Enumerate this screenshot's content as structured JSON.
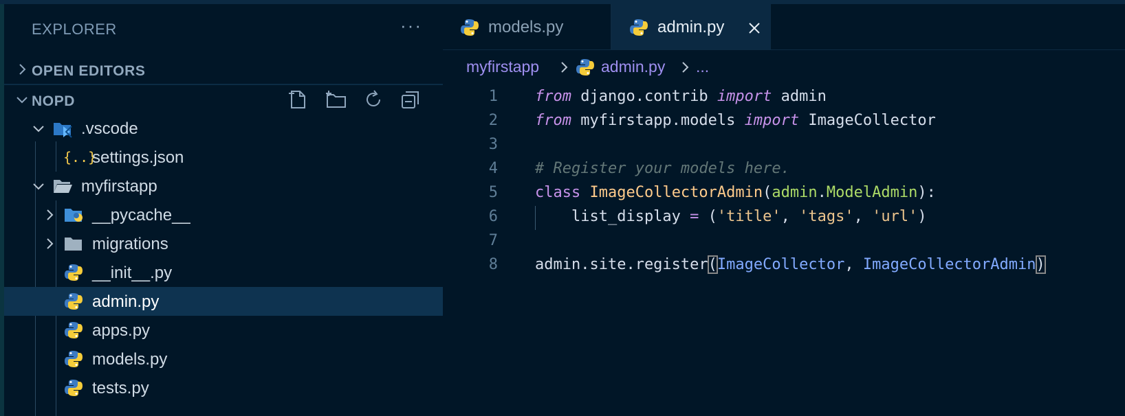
{
  "sidebar": {
    "title": "EXPLORER",
    "more_label": "···",
    "open_editors_label": "OPEN EDITORS",
    "project_label": "NOPD",
    "tree": [
      {
        "name": ".vscode",
        "kind": "folder-vscode",
        "expanded": true
      },
      {
        "name": "settings.json",
        "kind": "json"
      },
      {
        "name": "myfirstapp",
        "kind": "folder-open",
        "expanded": true
      },
      {
        "name": "__pycache__",
        "kind": "folder-python",
        "expanded": false
      },
      {
        "name": "migrations",
        "kind": "folder",
        "expanded": false
      },
      {
        "name": "__init__.py",
        "kind": "python"
      },
      {
        "name": "admin.py",
        "kind": "python",
        "selected": true
      },
      {
        "name": "apps.py",
        "kind": "python"
      },
      {
        "name": "models.py",
        "kind": "python"
      },
      {
        "name": "tests.py",
        "kind": "python"
      }
    ]
  },
  "tabs": [
    {
      "label": "models.py",
      "active": false
    },
    {
      "label": "admin.py",
      "active": true
    }
  ],
  "breadcrumb": {
    "folder": "myfirstapp",
    "file": "admin.py",
    "more": "..."
  },
  "code": {
    "line_numbers": [
      "1",
      "2",
      "3",
      "4",
      "5",
      "6",
      "7",
      "8"
    ],
    "lines": [
      "from django.contrib import admin",
      "from myfirstapp.models import ImageCollector",
      "",
      "# Register your models here.",
      "class ImageCollectorAdmin(admin.ModelAdmin):",
      "    list_display = ('title', 'tags', 'url')",
      "",
      "admin.site.register(ImageCollector, ImageCollectorAdmin)"
    ]
  },
  "colors": {
    "background": "#011627",
    "keyword": "#c792ea",
    "class_name": "#ffcb8b",
    "function": "#82aaff",
    "string": "#ecc48d",
    "comment": "#637777",
    "selection": "#0e3350",
    "breadcrumb": "#9f8ff0"
  }
}
